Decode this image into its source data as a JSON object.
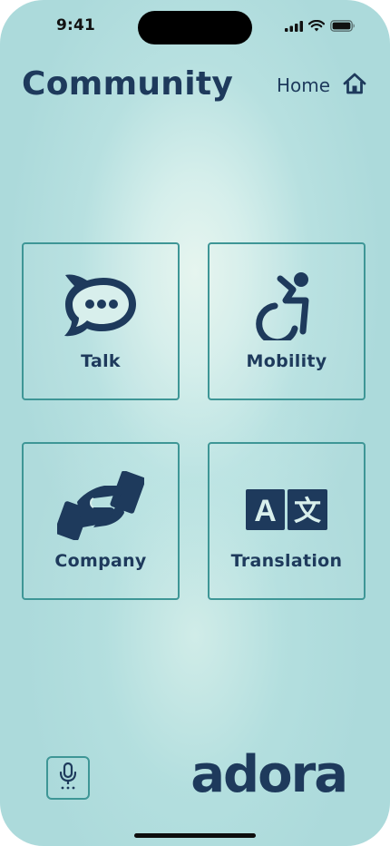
{
  "status_bar": {
    "time": "9:41"
  },
  "header": {
    "title": "Community",
    "home_label": "Home"
  },
  "tiles": [
    {
      "label": "Talk",
      "icon": "speech-bubble-icon"
    },
    {
      "label": "Mobility",
      "icon": "wheelchair-icon"
    },
    {
      "label": "Company",
      "icon": "handshake-icon"
    },
    {
      "label": "Translation",
      "icon": "translate-icon"
    }
  ],
  "translation_icon": {
    "left_glyph": "A",
    "right_glyph": "文"
  },
  "footer": {
    "mic_icon": "microphone-icon",
    "brand": "adora"
  },
  "colors": {
    "primary": "#1e3a5c",
    "border": "#3e9696",
    "background": "#acdadb"
  }
}
